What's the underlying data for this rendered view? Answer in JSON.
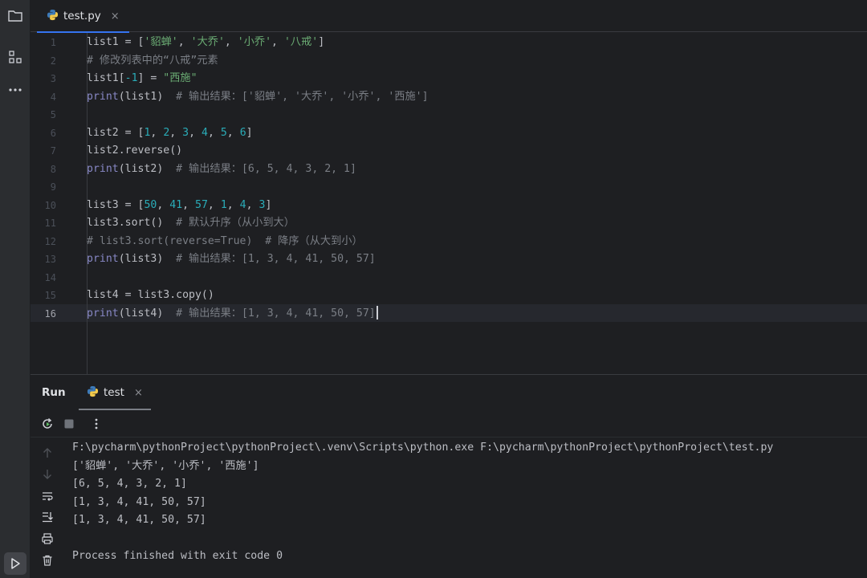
{
  "editor": {
    "tab_label": "test.py",
    "tab_close": "×",
    "lines": [
      {
        "num": "1",
        "tokens": [
          {
            "t": "list1 = [",
            "c": "plain"
          },
          {
            "t": "'貂蝉'",
            "c": "str"
          },
          {
            "t": ", ",
            "c": "plain"
          },
          {
            "t": "'大乔'",
            "c": "str"
          },
          {
            "t": ", ",
            "c": "plain"
          },
          {
            "t": "'小乔'",
            "c": "str"
          },
          {
            "t": ", ",
            "c": "plain"
          },
          {
            "t": "'八戒'",
            "c": "str"
          },
          {
            "t": "]",
            "c": "plain"
          }
        ]
      },
      {
        "num": "2",
        "tokens": [
          {
            "t": "# 修改列表中的“八戒”元素",
            "c": "com"
          }
        ]
      },
      {
        "num": "3",
        "tokens": [
          {
            "t": "list1[",
            "c": "plain"
          },
          {
            "t": "-1",
            "c": "num"
          },
          {
            "t": "] = ",
            "c": "plain"
          },
          {
            "t": "\"西施\"",
            "c": "str"
          }
        ]
      },
      {
        "num": "4",
        "tokens": [
          {
            "t": "print",
            "c": "bi"
          },
          {
            "t": "(list1)  ",
            "c": "plain"
          },
          {
            "t": "# 输出结果：['貂蝉', '大乔', '小乔', '西施']",
            "c": "com"
          }
        ]
      },
      {
        "num": "5",
        "tokens": []
      },
      {
        "num": "6",
        "tokens": [
          {
            "t": "list2 = [",
            "c": "plain"
          },
          {
            "t": "1",
            "c": "num"
          },
          {
            "t": ", ",
            "c": "plain"
          },
          {
            "t": "2",
            "c": "num"
          },
          {
            "t": ", ",
            "c": "plain"
          },
          {
            "t": "3",
            "c": "num"
          },
          {
            "t": ", ",
            "c": "plain"
          },
          {
            "t": "4",
            "c": "num"
          },
          {
            "t": ", ",
            "c": "plain"
          },
          {
            "t": "5",
            "c": "num"
          },
          {
            "t": ", ",
            "c": "plain"
          },
          {
            "t": "6",
            "c": "num"
          },
          {
            "t": "]",
            "c": "plain"
          }
        ]
      },
      {
        "num": "7",
        "tokens": [
          {
            "t": "list2.reverse()",
            "c": "plain"
          }
        ]
      },
      {
        "num": "8",
        "tokens": [
          {
            "t": "print",
            "c": "bi"
          },
          {
            "t": "(list2)  ",
            "c": "plain"
          },
          {
            "t": "# 输出结果：[6, 5, 4, 3, 2, 1]",
            "c": "com"
          }
        ]
      },
      {
        "num": "9",
        "tokens": []
      },
      {
        "num": "10",
        "tokens": [
          {
            "t": "list3 = [",
            "c": "plain"
          },
          {
            "t": "50",
            "c": "num"
          },
          {
            "t": ", ",
            "c": "plain"
          },
          {
            "t": "41",
            "c": "num"
          },
          {
            "t": ", ",
            "c": "plain"
          },
          {
            "t": "57",
            "c": "num"
          },
          {
            "t": ", ",
            "c": "plain"
          },
          {
            "t": "1",
            "c": "num"
          },
          {
            "t": ", ",
            "c": "plain"
          },
          {
            "t": "4",
            "c": "num"
          },
          {
            "t": ", ",
            "c": "plain"
          },
          {
            "t": "3",
            "c": "num"
          },
          {
            "t": "]",
            "c": "plain"
          }
        ]
      },
      {
        "num": "11",
        "tokens": [
          {
            "t": "list3.sort()  ",
            "c": "plain"
          },
          {
            "t": "# 默认升序（从小到大）",
            "c": "com"
          }
        ]
      },
      {
        "num": "12",
        "tokens": [
          {
            "t": "# list3.sort(reverse=True)  # 降序（从大到小）",
            "c": "com"
          }
        ]
      },
      {
        "num": "13",
        "tokens": [
          {
            "t": "print",
            "c": "bi"
          },
          {
            "t": "(list3)  ",
            "c": "plain"
          },
          {
            "t": "# 输出结果：[1, 3, 4, 41, 50, 57]",
            "c": "com"
          }
        ]
      },
      {
        "num": "14",
        "tokens": []
      },
      {
        "num": "15",
        "tokens": [
          {
            "t": "list4 = list3.copy()",
            "c": "plain"
          }
        ]
      },
      {
        "num": "16",
        "tokens": [
          {
            "t": "print",
            "c": "bi"
          },
          {
            "t": "(list4)  ",
            "c": "plain"
          },
          {
            "t": "# 输出结果：[1, 3, 4, 41, 50, 57]",
            "c": "com"
          }
        ],
        "current": true
      }
    ]
  },
  "run": {
    "title": "Run",
    "tab_label": "test",
    "tab_close": "×",
    "console_lines": [
      "F:\\pycharm\\pythonProject\\pythonProject\\.venv\\Scripts\\python.exe F:\\pycharm\\pythonProject\\pythonProject\\test.py",
      "['貂蝉', '大乔', '小乔', '西施']",
      "[6, 5, 4, 3, 2, 1]",
      "[1, 3, 4, 41, 50, 57]",
      "[1, 3, 4, 41, 50, 57]",
      "",
      "Process finished with exit code 0"
    ]
  },
  "icons": {
    "project": "folder-icon",
    "structure": "structure-icon",
    "more": "more-icon",
    "python_file": "python-icon",
    "rerun": "rerun-icon",
    "stop": "stop-icon",
    "options": "kebab-icon",
    "run_tool": "run-icon"
  },
  "colors": {
    "accent": "#3574f0",
    "string": "#6aab73",
    "number": "#2aacb8",
    "comment": "#7a7e85",
    "builtin": "#8888c6"
  }
}
